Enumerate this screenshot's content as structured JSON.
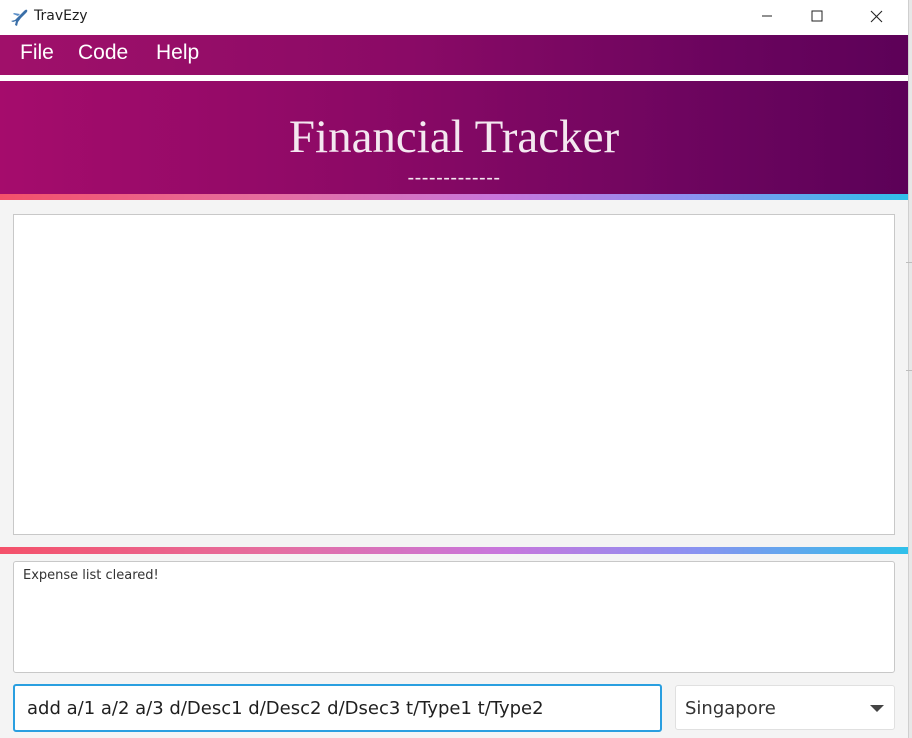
{
  "window": {
    "title": "TravEzy",
    "minimize_glyph": "—",
    "maximize_glyph": "☐",
    "close_glyph": "✕"
  },
  "menu": {
    "items": [
      {
        "label": "File"
      },
      {
        "label": "Code"
      },
      {
        "label": "Help"
      }
    ]
  },
  "header": {
    "title": "Financial Tracker",
    "underline": "-------------"
  },
  "result": {
    "message": "Expense list cleared!"
  },
  "command": {
    "value": "add a/1 a/2 a/3 d/Desc1 d/Desc2 d/Dsec3 t/Type1 t/Type2"
  },
  "country": {
    "selected": "Singapore"
  },
  "colors": {
    "menu_gradient_start": "#a0106a",
    "menu_gradient_end": "#5d0158",
    "input_focus": "#2a9fe0"
  },
  "icons": {
    "app": "airplane-icon",
    "dropdown": "chevron-down-icon"
  }
}
